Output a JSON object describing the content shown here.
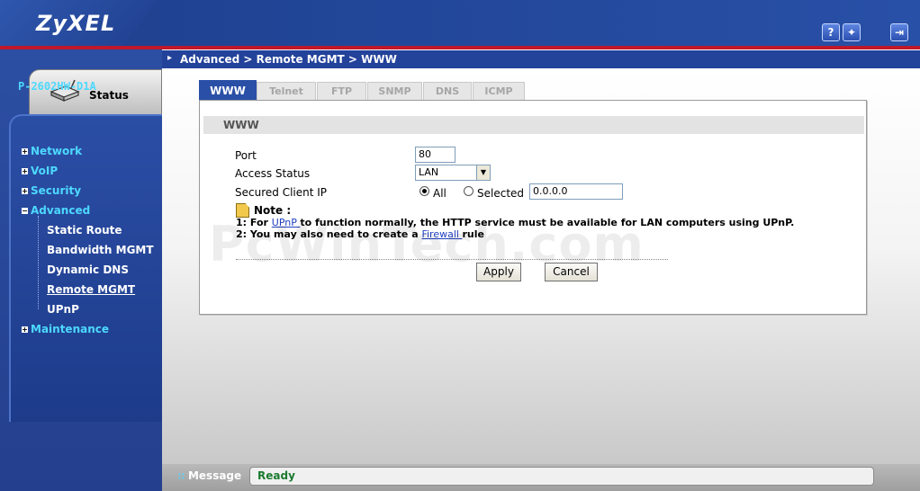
{
  "brand": {
    "logo": "ZyXEL"
  },
  "top_icons": [
    {
      "name": "help-icon",
      "glyph": "?"
    },
    {
      "name": "wizard-icon",
      "glyph": "✦"
    },
    {
      "name": "logout-icon",
      "glyph": "⇥"
    }
  ],
  "sidebar": {
    "status_label": "Status",
    "device_name": "P-2602HW-D1A",
    "items": [
      {
        "label": "Network",
        "type": "top",
        "expander": "+"
      },
      {
        "label": "VoIP",
        "type": "top",
        "expander": "+"
      },
      {
        "label": "Security",
        "type": "top",
        "expander": "+"
      },
      {
        "label": "Advanced",
        "type": "top",
        "expander": "−"
      },
      {
        "label": "Static Route",
        "type": "sub"
      },
      {
        "label": "Bandwidth MGMT",
        "type": "sub"
      },
      {
        "label": "Dynamic DNS",
        "type": "sub"
      },
      {
        "label": "Remote MGMT",
        "type": "sub",
        "active": true
      },
      {
        "label": "UPnP",
        "type": "sub"
      },
      {
        "label": "Maintenance",
        "type": "top",
        "expander": "+"
      }
    ]
  },
  "breadcrumb": "Advanced > Remote MGMT > WWW",
  "tabs": [
    {
      "label": "WWW",
      "active": true
    },
    {
      "label": "Telnet"
    },
    {
      "label": "FTP"
    },
    {
      "label": "SNMP"
    },
    {
      "label": "DNS"
    },
    {
      "label": "ICMP"
    }
  ],
  "form": {
    "section_title": "WWW",
    "port_label": "Port",
    "port_value": "80",
    "access_status_label": "Access Status",
    "access_status_value": "LAN",
    "secured_ip_label": "Secured Client IP",
    "radio_all_label": "All",
    "radio_selected_label": "Selected",
    "selected_ip_value": "0.0.0.0"
  },
  "note": {
    "title": "Note :",
    "line1_prefix": "1: For ",
    "line1_link": "UPnP ",
    "line1_suffix": "to function normally, the HTTP service must be available for LAN computers using UPnP.",
    "line2_prefix": "2: You may also need to create a ",
    "line2_link": "Firewall ",
    "line2_suffix": "rule"
  },
  "buttons": {
    "apply": "Apply",
    "cancel": "Cancel"
  },
  "watermark": "PcWinTech.com",
  "message_bar": {
    "label": "Message",
    "status": "Ready"
  },
  "colors": {
    "brand_blue": "#23429a",
    "accent_red": "#c0182a",
    "nav_cyan": "#4dd9ff",
    "ready_green": "#1c7a2f"
  }
}
